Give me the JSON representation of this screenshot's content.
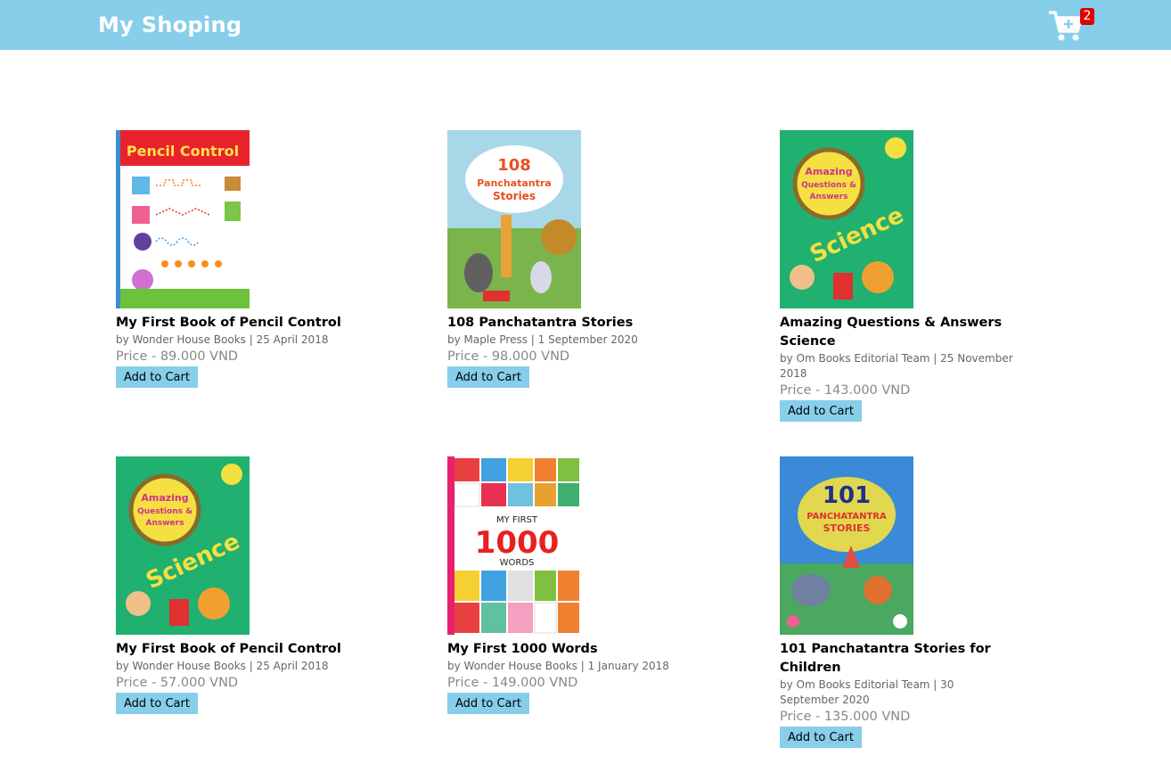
{
  "header": {
    "brand": "My Shoping",
    "cart_count": "2"
  },
  "products": [
    {
      "title": "My First Book of Pencil Control",
      "meta": "by Wonder House Books | 25 April 2018",
      "price": "Price - 89.000 VND",
      "button": "Add to Cart",
      "cover_text": "Pencil Control"
    },
    {
      "title": "108 Panchatantra Stories",
      "meta": "by Maple Press | 1 September 2020",
      "price": "Price - 98.000 VND",
      "button": "Add to Cart",
      "cover_text": "108 Panchatantra Stories"
    },
    {
      "title": "Amazing Questions & Answers Science",
      "meta": "by Om Books Editorial Team | 25 November 2018",
      "price": "Price - 143.000 VND",
      "button": "Add to Cart",
      "cover_text": "Science"
    },
    {
      "title": "My First Book of Pencil Control",
      "meta": "by Wonder House Books | 25 April 2018",
      "price": "Price - 57.000 VND",
      "button": "Add to Cart",
      "cover_text": "Science"
    },
    {
      "title": "My First 1000 Words",
      "meta": "by Wonder House Books | 1 January 2018",
      "price": "Price - 149.000 VND",
      "button": "Add to Cart",
      "cover_text": "MY FIRST 1000 WORDS"
    },
    {
      "title": "101 Panchatantra Stories for Children",
      "meta": "by Om Books Editorial Team | 30 September 2020",
      "price": "Price - 135.000 VND",
      "button": "Add to Cart",
      "cover_text": "101 PANCHATANTRA STORIES"
    }
  ]
}
